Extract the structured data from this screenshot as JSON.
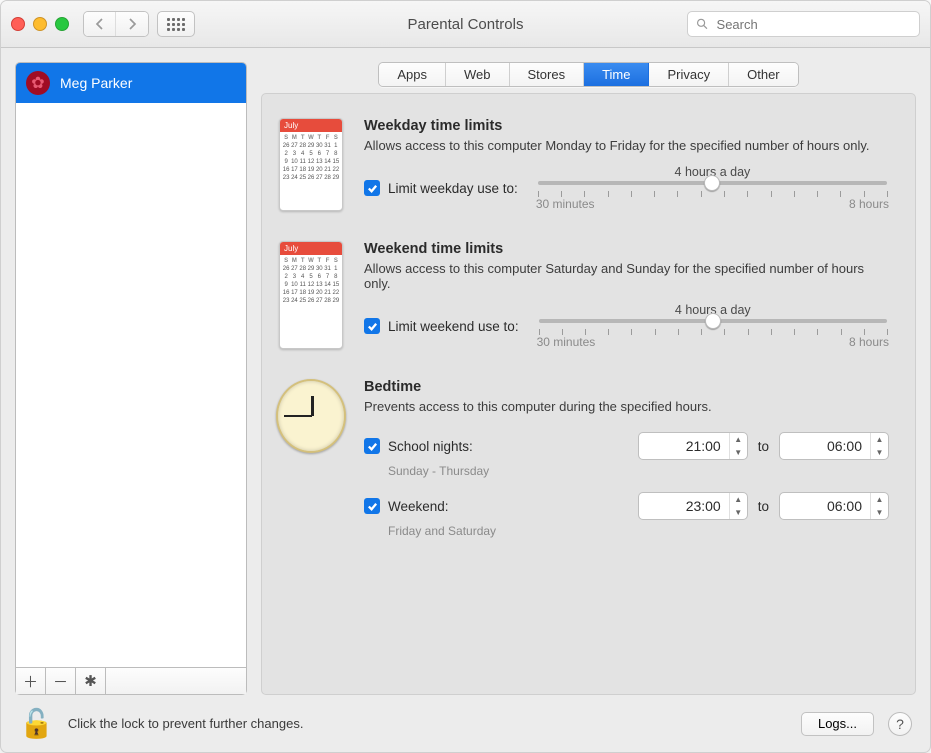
{
  "window": {
    "title": "Parental Controls"
  },
  "search": {
    "placeholder": "Search"
  },
  "sidebar": {
    "users": [
      {
        "name": "Meg Parker"
      }
    ]
  },
  "tabs": [
    "Apps",
    "Web",
    "Stores",
    "Time",
    "Privacy",
    "Other"
  ],
  "tab_selected": "Time",
  "cal_month": "July",
  "weekday": {
    "title": "Weekday time limits",
    "desc": "Allows access to this computer Monday to Friday for the specified number of hours only.",
    "check_label": "Limit weekday use to:",
    "value_label": "4 hours a day",
    "min_label": "30 minutes",
    "max_label": "8 hours",
    "thumb_pct": 50
  },
  "weekend": {
    "title": "Weekend time limits",
    "desc": "Allows access to this computer Saturday and Sunday for the specified number of hours only.",
    "check_label": "Limit weekend use to:",
    "value_label": "4 hours a day",
    "min_label": "30 minutes",
    "max_label": "8 hours",
    "thumb_pct": 50
  },
  "bedtime": {
    "title": "Bedtime",
    "desc": "Prevents access to this computer during the specified hours.",
    "to_label": "to",
    "school": {
      "label": "School nights:",
      "note": "Sunday - Thursday",
      "from": "21:00",
      "to": "06:00"
    },
    "weekend": {
      "label": "Weekend:",
      "note": "Friday and Saturday",
      "from": "23:00",
      "to": "06:00"
    }
  },
  "footer": {
    "msg": "Click the lock to prevent further changes.",
    "logs": "Logs...",
    "help": "?"
  }
}
